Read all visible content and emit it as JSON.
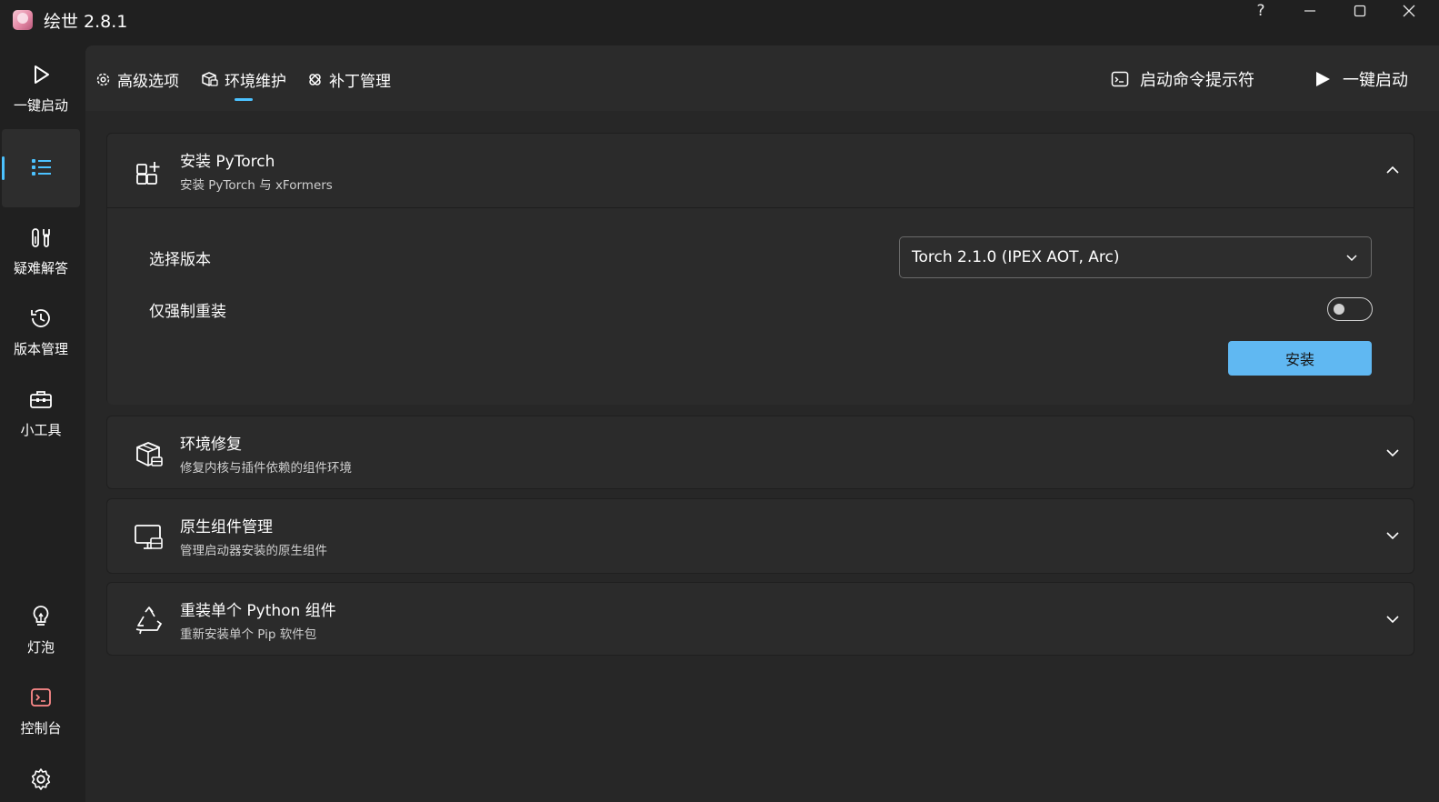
{
  "window": {
    "title": "绘世 2.8.1",
    "help": "?",
    "minimize": "—",
    "maximize": "☐",
    "close": "✕"
  },
  "sidebar": {
    "items": [
      {
        "label": "一键启动",
        "icon": "play-icon"
      },
      {
        "label": "",
        "icon": "list-icon",
        "active": true
      },
      {
        "label": "疑难解答",
        "icon": "wrench-icon"
      },
      {
        "label": "版本管理",
        "icon": "history-icon"
      },
      {
        "label": "小工具",
        "icon": "toolbox-icon"
      },
      {
        "label": "灯泡",
        "icon": "lightbulb-icon"
      },
      {
        "label": "控制台",
        "icon": "console-icon"
      },
      {
        "label": "",
        "icon": "gear-icon"
      }
    ]
  },
  "tabs": [
    {
      "label": "高级选项",
      "icon": "settings-icon"
    },
    {
      "label": "环境维护",
      "icon": "package-icon",
      "active": true
    },
    {
      "label": "补丁管理",
      "icon": "patch-icon"
    }
  ],
  "top_actions": {
    "console": "启动命令提示符",
    "launch": "一键启动"
  },
  "cards": [
    {
      "title": "安装 PyTorch",
      "subtitle": "安装 PyTorch 与 xFormers",
      "icon": "add-grid-icon",
      "expanded": true,
      "version_label": "选择版本",
      "version_value": "Torch 2.1.0 (IPEX AOT, Arc)",
      "force_label": "仅强制重装",
      "force_on": false,
      "install_label": "安装"
    },
    {
      "title": "环境修复",
      "subtitle": "修复内核与插件依赖的组件环境",
      "icon": "package-repair-icon",
      "expanded": false
    },
    {
      "title": "原生组件管理",
      "subtitle": "管理启动器安装的原生组件",
      "icon": "monitor-package-icon",
      "expanded": false
    },
    {
      "title": "重装单个 Python 组件",
      "subtitle": "重新安装单个 Pip 软件包",
      "icon": "recycle-icon",
      "expanded": false
    }
  ],
  "colors": {
    "accent": "#4cc2ff",
    "button": "#60b8f2",
    "console_icon": "#ff8a8a"
  }
}
